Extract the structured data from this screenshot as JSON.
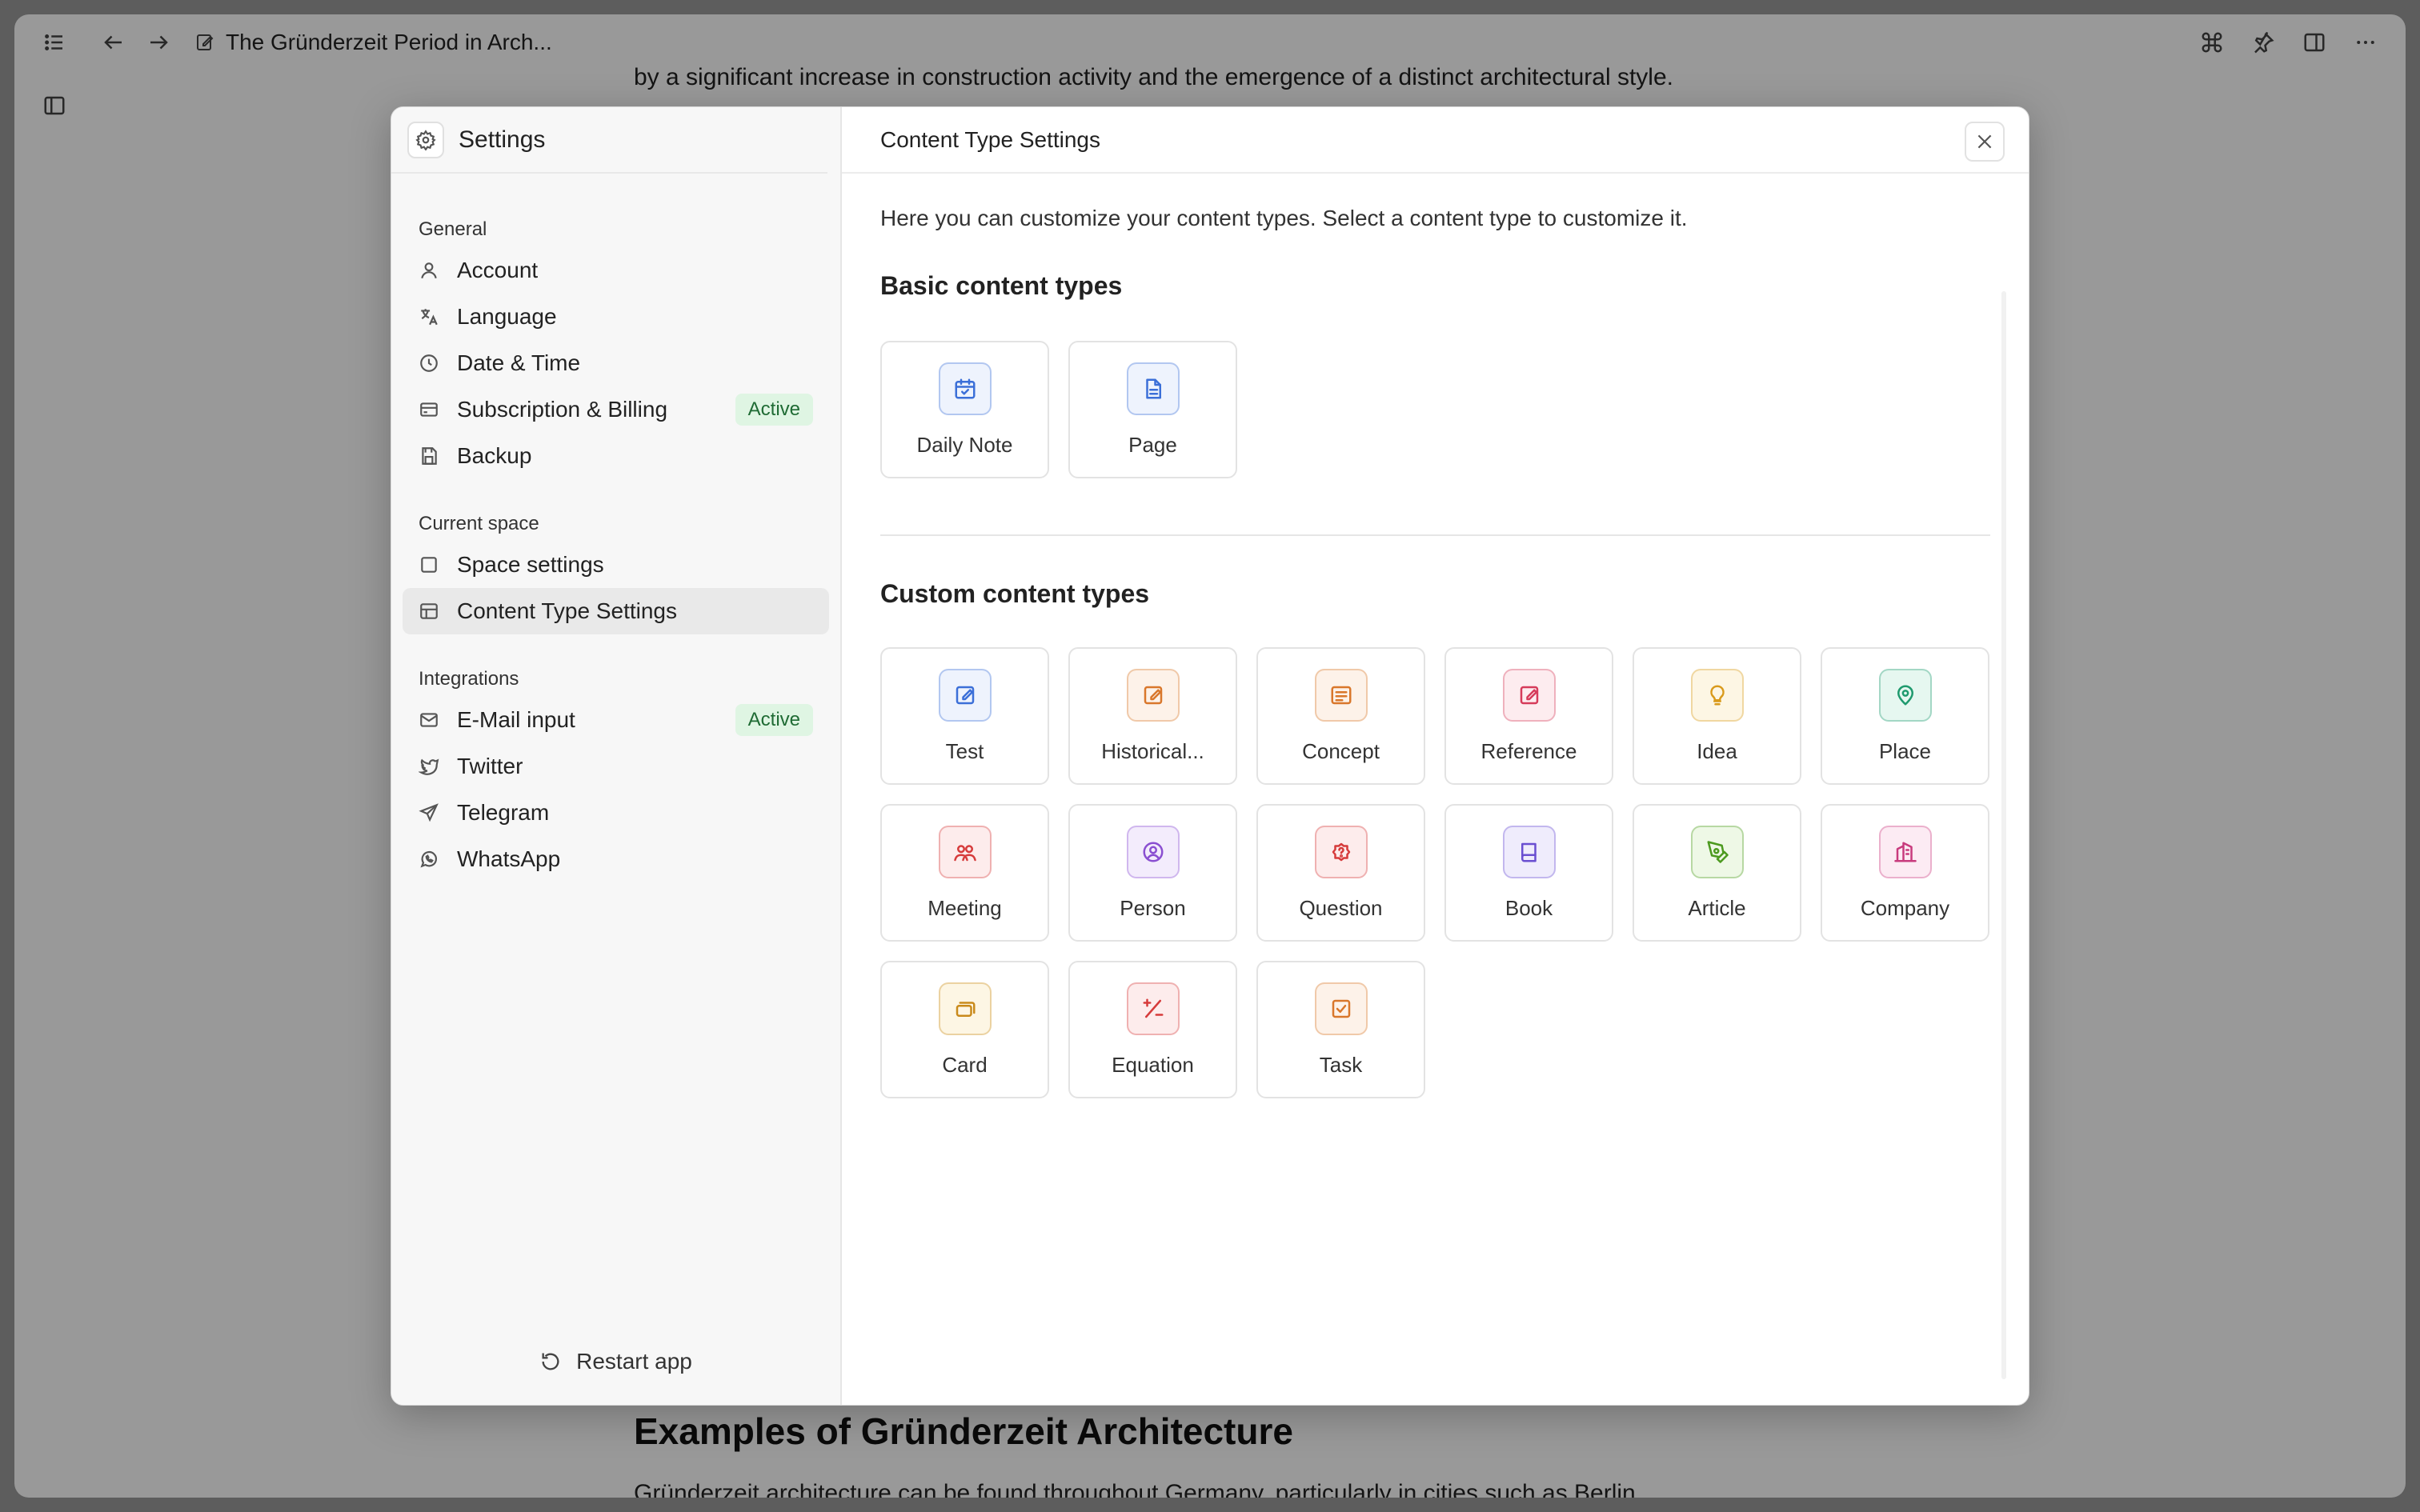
{
  "window": {
    "doc_title": "The Gründerzeit Period in Arch...",
    "bg_text_top": "by a significant increase in construction activity and the emergence of a distinct architectural style.",
    "bg_heading": "Examples of Gründerzeit Architecture",
    "bg_text_bottom": "Gründerzeit architecture can be found throughout Germany, particularly in cities such as Berlin,"
  },
  "sidebar": {
    "title": "Settings",
    "sections": [
      {
        "label": "General",
        "items": [
          {
            "label": "Account",
            "icon": "user-icon",
            "badge": ""
          },
          {
            "label": "Language",
            "icon": "translate-icon",
            "badge": ""
          },
          {
            "label": "Date & Time",
            "icon": "clock-icon",
            "badge": ""
          },
          {
            "label": "Subscription & Billing",
            "icon": "credit-card-icon",
            "badge": "Active"
          },
          {
            "label": "Backup",
            "icon": "save-icon",
            "badge": ""
          }
        ]
      },
      {
        "label": "Current space",
        "items": [
          {
            "label": "Space settings",
            "icon": "square-icon",
            "badge": ""
          },
          {
            "label": "Content Type Settings",
            "icon": "table-icon",
            "badge": "",
            "selected": true
          }
        ]
      },
      {
        "label": "Integrations",
        "items": [
          {
            "label": "E-Mail input",
            "icon": "mail-icon",
            "badge": "Active"
          },
          {
            "label": "Twitter",
            "icon": "twitter-icon",
            "badge": ""
          },
          {
            "label": "Telegram",
            "icon": "send-icon",
            "badge": ""
          },
          {
            "label": "WhatsApp",
            "icon": "whatsapp-icon",
            "badge": ""
          }
        ]
      }
    ],
    "restart_label": "Restart app"
  },
  "main": {
    "title": "Content Type Settings",
    "intro": "Here you can customize your content types. Select a content type to customize it.",
    "basic_title": "Basic content types",
    "custom_title": "Custom content types",
    "basic_types": [
      {
        "label": "Daily Note",
        "icon": "calendar-check-icon",
        "color": "#3b6fd8",
        "bg": "#eef3fd"
      },
      {
        "label": "Page",
        "icon": "file-text-icon",
        "color": "#3b6fd8",
        "bg": "#eef3fd"
      }
    ],
    "custom_types": [
      {
        "label": "Test",
        "icon": "edit-icon",
        "color": "#3b6fd8",
        "bg": "#eef3fd"
      },
      {
        "label": "Historical...",
        "icon": "edit-icon",
        "color": "#d9772b",
        "bg": "#fdf2e9"
      },
      {
        "label": "Concept",
        "icon": "list-box-icon",
        "color": "#d9772b",
        "bg": "#fdf2e9"
      },
      {
        "label": "Reference",
        "icon": "edit-icon",
        "color": "#d63b5a",
        "bg": "#fdecef"
      },
      {
        "label": "Idea",
        "icon": "lightbulb-icon",
        "color": "#d99a1b",
        "bg": "#fdf6e4"
      },
      {
        "label": "Place",
        "icon": "map-pin-icon",
        "color": "#1f9a6e",
        "bg": "#e6f7f0"
      },
      {
        "label": "Meeting",
        "icon": "users-icon",
        "color": "#d63b3b",
        "bg": "#fdecec"
      },
      {
        "label": "Person",
        "icon": "user-circle-icon",
        "color": "#8a4fd1",
        "bg": "#f3ecfc"
      },
      {
        "label": "Question",
        "icon": "help-circle-icon",
        "color": "#d63b3b",
        "bg": "#fdecec"
      },
      {
        "label": "Book",
        "icon": "book-icon",
        "color": "#6a4fd1",
        "bg": "#efecfc"
      },
      {
        "label": "Article",
        "icon": "pen-tool-icon",
        "color": "#4c9a1f",
        "bg": "#eef8e6"
      },
      {
        "label": "Company",
        "icon": "building-icon",
        "color": "#c83b7d",
        "bg": "#fcebf3"
      },
      {
        "label": "Card",
        "icon": "cards-icon",
        "color": "#c98a1b",
        "bg": "#fdf6e4"
      },
      {
        "label": "Equation",
        "icon": "plus-minus-icon",
        "color": "#d63b3b",
        "bg": "#fdecec"
      },
      {
        "label": "Task",
        "icon": "check-square-icon",
        "color": "#d9772b",
        "bg": "#fdf2e9"
      }
    ]
  }
}
